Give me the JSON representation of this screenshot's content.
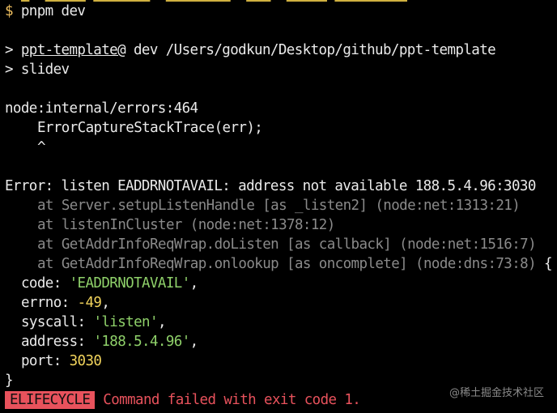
{
  "prompt": {
    "symbol": "$",
    "command": "pnpm dev"
  },
  "run": {
    "arrow": ">",
    "package": "ppt-template@",
    "script_and_path": " dev /Users/godkun/Desktop/github/ppt-template",
    "script_line": "> slidev"
  },
  "trace_head": {
    "location": "node:internal/errors:464",
    "code": "ErrorCaptureStackTrace(err);",
    "caret": "^"
  },
  "error": {
    "message": "Error: listen EADDRNOTAVAIL: address not available 188.5.4.96:3030",
    "frames": [
      {
        "at": "at",
        "fn": "Server.setupListenHandle",
        "extra": "[as _listen2]",
        "loc": "(node:net:1313:21)"
      },
      {
        "at": "at",
        "fn": "listenInCluster",
        "extra": "",
        "loc": "(node:net:1378:12)"
      },
      {
        "at": "at",
        "fn": "GetAddrInfoReqWrap.doListen",
        "extra": "[as callback]",
        "loc": "(node:net:1516:7)"
      },
      {
        "at": "at",
        "fn": "GetAddrInfoReqWrap.onlookup",
        "extra": "[as oncomplete]",
        "loc": "(node:dns:73:8)",
        "tail": "{"
      }
    ],
    "fields": {
      "code_key": "code: ",
      "code_val": "'EADDRNOTAVAIL'",
      "errno_key": "errno: ",
      "errno_val": "-49",
      "syscall_key": "syscall: ",
      "syscall_val": "'listen'",
      "address_key": "address: ",
      "address_val": "'188.5.4.96'",
      "port_key": "port: ",
      "port_val": "3030",
      "comma": ","
    },
    "close_brace": "}"
  },
  "lifecycle": {
    "badge": "ELIFECYCLE",
    "message": "Command failed with exit code 1."
  },
  "watermark": "@稀土掘金技术社区",
  "colors": {
    "background": "#000000",
    "text": "#eaeaea",
    "prompt": "#f0c060",
    "dim": "#8a8a8a",
    "string": "#8fd16a",
    "number": "#f2d45c",
    "error": "#e8525c"
  }
}
